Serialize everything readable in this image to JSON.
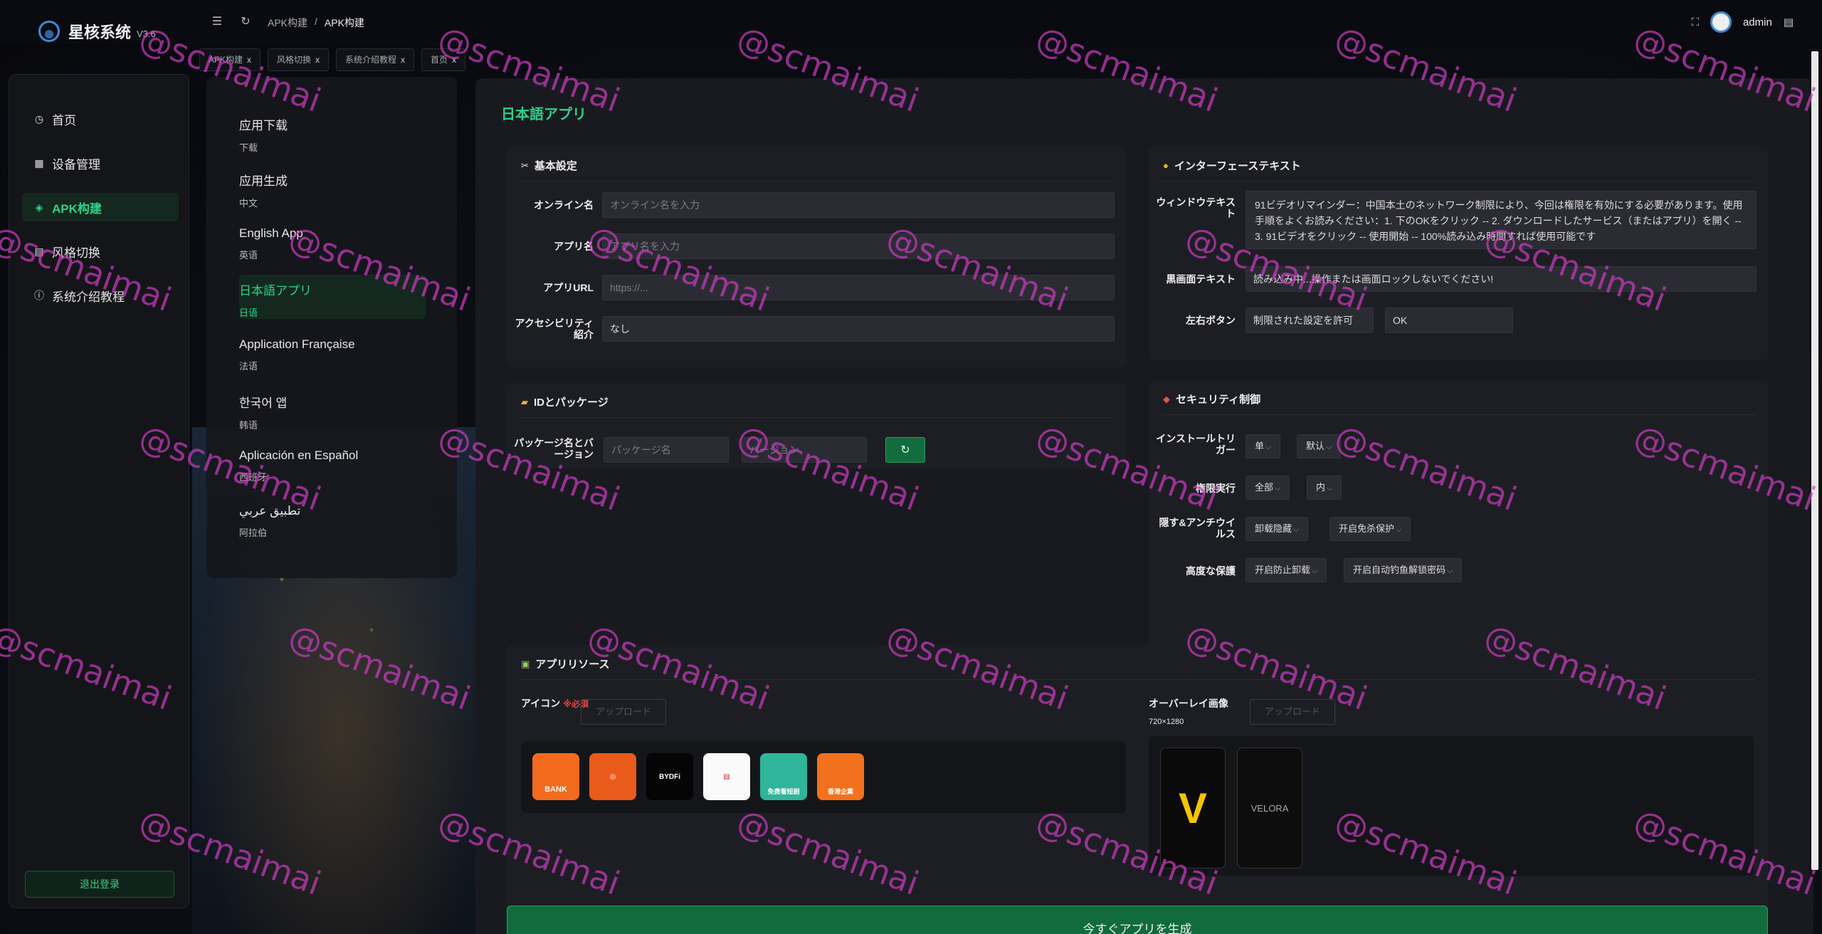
{
  "brand": {
    "name": "星核系统",
    "version": "V3.6"
  },
  "breadcrumb": {
    "parent": "APK构建",
    "separator": "/",
    "current": "APK构建"
  },
  "user": {
    "name": "admin"
  },
  "tabs": [
    {
      "label": "APK构建"
    },
    {
      "label": "风格切换"
    },
    {
      "label": "系统介绍教程"
    },
    {
      "label": "首页"
    }
  ],
  "sidebar": {
    "items": [
      {
        "label": "首页",
        "icon": "clock-icon"
      },
      {
        "label": "设备管理",
        "icon": "grid-icon"
      },
      {
        "label": "APK构建",
        "icon": "box-icon"
      },
      {
        "label": "风格切换",
        "icon": "doc-icon"
      },
      {
        "label": "系统介绍教程",
        "icon": "info-icon"
      }
    ],
    "logout": "退出登录"
  },
  "languages": [
    {
      "title": "应用下载",
      "sub": "下载"
    },
    {
      "title": "应用生成",
      "sub": "中文"
    },
    {
      "title": "English App",
      "sub": "英语"
    },
    {
      "title": "日本語アプリ",
      "sub": "日语"
    },
    {
      "title": "Application Française",
      "sub": "法语"
    },
    {
      "title": "한국어 앱",
      "sub": "韩语"
    },
    {
      "title": "Aplicación en Español",
      "sub": "西班牙"
    },
    {
      "title": "تطبيق عربي",
      "sub": "阿拉伯"
    }
  ],
  "main": {
    "title": "日本語アプリ",
    "basic": {
      "title": "基本設定",
      "online_label": "オンライン名",
      "online_ph": "オンライン名を入力",
      "app_label": "アプリ名",
      "app_ph": "アプリ名を入力",
      "url_label": "アプリURL",
      "url_ph": "https://...",
      "access_label": "アクセシビリティ紹介",
      "access_value": "なし"
    },
    "iface": {
      "title": "インターフェーステキスト",
      "window_label": "ウィンドウテキスト",
      "window_value": "91ビデオリマインダー：中国本土のネットワーク制限により、今回は権限を有効にする必要があります。使用手順をよくお読みください：1. 下のOKをクリック -- 2. ダウンロードしたサービス（またはアプリ）を開く -- 3. 91ビデオをクリック -- 使用開始 -- 100%読み込み時間すれば使用可能です",
      "black_label": "黒画面テキスト",
      "black_value": "読み込み中...操作または画面ロックしないでください!",
      "lr_label": "左右ボタン",
      "left_btn": "制限された設定を許可",
      "right_btn": "OK"
    },
    "id": {
      "title": "IDとパッケージ",
      "pkg_label": "パッケージ名とバージョン",
      "pkg_ph": "パッケージ名",
      "ver_ph": "バージョン"
    },
    "security": {
      "title": "セキュリティ制御",
      "install_label": "インストールトリガー",
      "install_a": "单",
      "install_b": "默认",
      "perm_label": "権限実行",
      "perm_a": "全部",
      "perm_b": "内",
      "hide_label": "隠す&アンチウイルス",
      "hide_a": "卸载隐藏",
      "hide_b": "开启免杀保护",
      "adv_label": "高度な保護",
      "adv_a": "开启防止卸载",
      "adv_b": "开启自动钓鱼解锁密码"
    },
    "resource": {
      "title": "アプリリソース",
      "icon_label": "アイコン",
      "required": "※必須",
      "upload": "アップロード",
      "overlay_label": "オーバーレイ画像",
      "overlay_size": "720×1280",
      "icons": [
        "BANK",
        "",
        "BYDFi",
        "",
        "免费看短剧",
        "香港企業"
      ],
      "overlay_texts": [
        "",
        "VELORA"
      ]
    },
    "generate": "今すぐアプリを生成"
  },
  "watermark": "@scmaimai",
  "colors": {
    "accent": "#2fd18a",
    "primary_button": "#116b3c",
    "watermark": "#cd3cc3"
  }
}
